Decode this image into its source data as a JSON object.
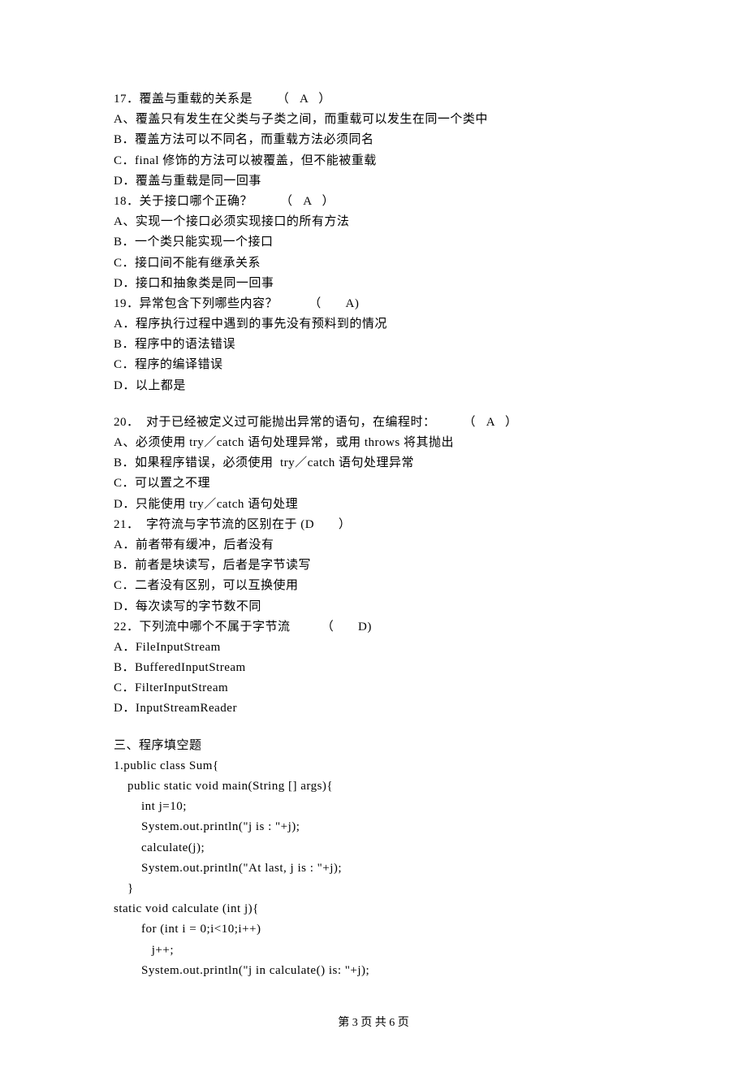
{
  "lines": [
    "17．覆盖与重载的关系是       （   A   ）",
    "A、覆盖只有发生在父类与子类之间，而重载可以发生在同一个类中",
    "B．覆盖方法可以不同名，而重载方法必须同名",
    "C．final 修饰的方法可以被覆盖，但不能被重载",
    "D．覆盖与重载是同一回事",
    "18．关于接口哪个正确？        （   A   ）",
    "A、实现一个接口必须实现接口的所有方法",
    "B．一个类只能实现一个接口",
    "C．接口间不能有继承关系",
    "D．接口和抽象类是同一回事",
    "19．异常包含下列哪些内容？         （       A)",
    "A．程序执行过程中遇到的事先没有预料到的情况",
    "B．程序中的语法错误",
    "C．程序的编译错误",
    "D．以上都是",
    "",
    "20．  对于已经被定义过可能抛出异常的语句，在编程时：        （   A   ）",
    "A、必须使用 try／catch 语句处理异常，或用 throws 将其抛出",
    "B．如果程序错误，必须使用  try／catch 语句处理异常",
    "C．可以置之不理",
    "D．只能使用 try／catch 语句处理",
    "21．  字符流与字节流的区别在于 (D       ）",
    "A．前者带有缓冲，后者没有",
    "B．前者是块读写，后者是字节读写",
    "C．二者没有区别，可以互换使用",
    "D．每次读写的字节数不同",
    "22．下列流中哪个不属于字节流         （       D)",
    "A．FileInputStream",
    "B．BufferedInputStream",
    "C．FilterInputStream",
    "D．InputStreamReader",
    "",
    "三、程序填空题",
    "1.public class Sum{",
    "    public static void main(String [] args){",
    "        int j=10;",
    "        System.out.println(\"j is : \"+j);",
    "        calculate(j);",
    "        System.out.println(\"At last, j is : \"+j);",
    "    }",
    "static void calculate (int j){",
    "        for (int i = 0;i<10;i++)",
    "           j++;",
    "        System.out.println(\"j in calculate() is: \"+j);"
  ],
  "footer": "第 3  页 共 6  页"
}
